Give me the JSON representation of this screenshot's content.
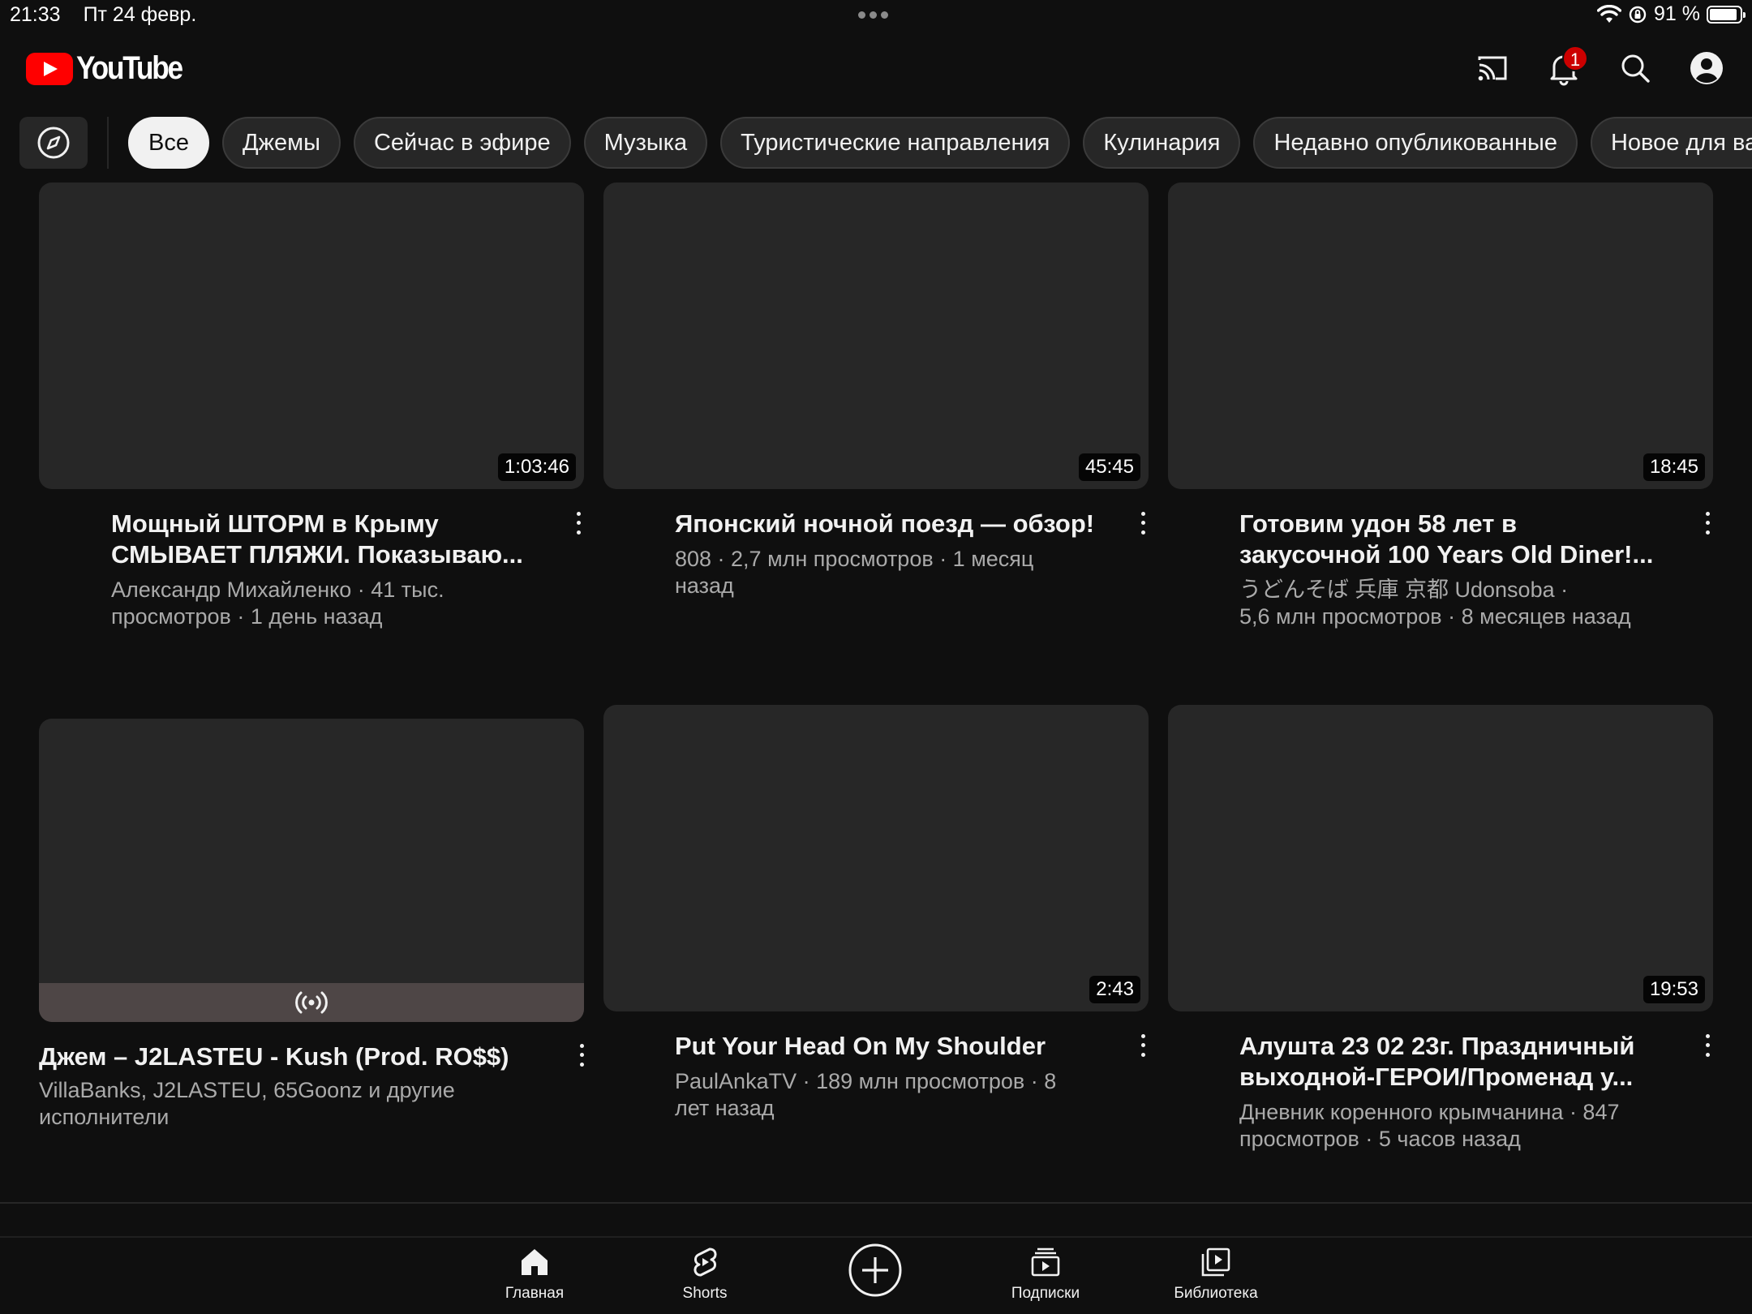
{
  "status_bar": {
    "time": "21:33",
    "date": "Пт 24 февр.",
    "battery": "91 %",
    "battery_level": 0.91
  },
  "header": {
    "logo_text": "YouTube",
    "notification_count": "1"
  },
  "chips": [
    {
      "label": "Все",
      "active": true
    },
    {
      "label": "Джемы"
    },
    {
      "label": "Сейчас в эфире"
    },
    {
      "label": "Музыка"
    },
    {
      "label": "Туристические направления"
    },
    {
      "label": "Кулинария"
    },
    {
      "label": "Недавно опубликованные"
    },
    {
      "label": "Новое для вас"
    }
  ],
  "videos": [
    {
      "title_line1": "Мощный ШТОРМ в Крыму",
      "title_line2": "СМЫВАЕТ ПЛЯЖИ. Показываю...",
      "meta_line1": "Александр Михайленко · 41 тыс.",
      "meta_line2": "просмотров · 1 день назад",
      "duration": "1:03:46"
    },
    {
      "title_line1": "Японский ночной поезд — обзор!",
      "title_line2": "",
      "meta_line1": "808 · 2,7 млн просмотров · 1 месяц",
      "meta_line2": "назад",
      "duration": "45:45"
    },
    {
      "title_line1": "Готовим удон 58 лет в",
      "title_line2": "закусочной 100 Years Old Diner!...",
      "meta_line1": "うどんそば 兵庫 京都 Udonsoba ·",
      "meta_line2": "5,6 млн просмотров · 8 месяцев назад",
      "duration": "18:45"
    },
    {
      "title_line1": "Джем – J2LASTEU - Kush (Prod. RO$$)",
      "title_line2": "",
      "meta_line1": "VillaBanks, J2LASTEU, 65Goonz и другие",
      "meta_line2": "исполнители",
      "duration": ""
    },
    {
      "title_line1": "Put Your Head On My Shoulder",
      "title_line2": "",
      "meta_line1": "PaulAnkaTV · 189 млн просмотров · 8",
      "meta_line2": "лет назад",
      "duration": "2:43"
    },
    {
      "title_line1": "Алушта 23 02 23г. Праздничный",
      "title_line2": "выходной-ГЕРОИ/Променад у...",
      "meta_line1": "Дневник коренного крымчанина · 847",
      "meta_line2": "просмотров · 5 часов назад",
      "duration": "19:53"
    }
  ],
  "bottom_nav": [
    {
      "label": "Главная",
      "icon": "home-icon"
    },
    {
      "label": "Shorts",
      "icon": "shorts-icon"
    },
    {
      "label": "",
      "icon": "create-icon"
    },
    {
      "label": "Подписки",
      "icon": "subscriptions-icon"
    },
    {
      "label": "Библиотека",
      "icon": "library-icon"
    }
  ],
  "colors": {
    "background": "#0f0f0f",
    "chip": "#272727",
    "brand_red": "#ff0000",
    "badge_red": "#cc0000",
    "meta_text": "#aaaaaa"
  }
}
